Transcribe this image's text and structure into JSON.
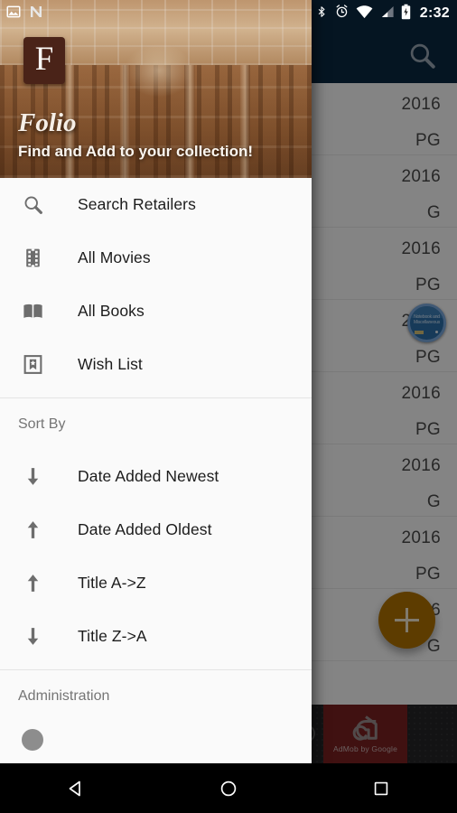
{
  "statusbar": {
    "time": "2:32",
    "icons": [
      "photo-icon",
      "nougat-n-icon",
      "bluetooth-icon",
      "alarm-icon",
      "wifi-icon",
      "cell-signal-icon",
      "battery-charging-icon"
    ]
  },
  "app": {
    "toolbar": {
      "search_icon": "search-icon",
      "background_color": "#0b2841"
    },
    "fab": {
      "icon": "plus-icon",
      "color": "#b07200"
    },
    "list_columns": [
      "year",
      "rating"
    ],
    "list_rows": [
      {
        "year": "2016",
        "rating": "PG"
      },
      {
        "year": "2016",
        "rating": "G"
      },
      {
        "year": "2016",
        "rating": "PG"
      },
      {
        "year": "2016",
        "rating": "PG"
      },
      {
        "year": "2016",
        "rating": "PG"
      },
      {
        "year": "2016",
        "rating": "G"
      },
      {
        "year": "2016",
        "rating": "PG"
      },
      {
        "year": "2016",
        "rating": "G"
      }
    ],
    "avatar_badge": {
      "caption": "Notebook and Miscellaneous"
    },
    "ad": {
      "label": "AdMob by Google",
      "logo": "admob-logo-icon",
      "background_color": "#7a2020"
    }
  },
  "drawer": {
    "header": {
      "logo_letter": "F",
      "title": "Folio",
      "subtitle": "Find and Add to your collection!",
      "background_image": "library-interior-photo"
    },
    "nav_items": [
      {
        "label": "Search Retailers",
        "icon": "search-icon"
      },
      {
        "label": "All Movies",
        "icon": "film-strip-icon"
      },
      {
        "label": "All Books",
        "icon": "open-book-icon"
      },
      {
        "label": "Wish List",
        "icon": "bookmark-star-icon"
      }
    ],
    "sort_section": {
      "title": "Sort By",
      "items": [
        {
          "label": "Date Added Newest",
          "icon": "arrow-down-icon"
        },
        {
          "label": "Date Added Oldest",
          "icon": "arrow-up-icon"
        },
        {
          "label": "Title A->Z",
          "icon": "arrow-up-icon"
        },
        {
          "label": "Title Z->A",
          "icon": "arrow-down-icon"
        }
      ]
    },
    "admin_section": {
      "title": "Administration"
    }
  },
  "navbar": {
    "back": "back-icon",
    "home": "home-icon",
    "recents": "recents-icon"
  }
}
